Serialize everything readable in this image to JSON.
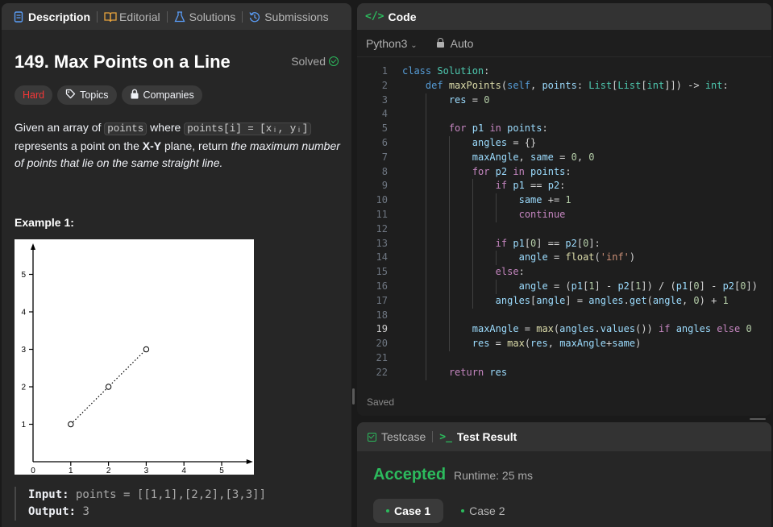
{
  "left_tabs": [
    {
      "label": "Description",
      "icon": "description-icon",
      "active": true
    },
    {
      "label": "Editorial",
      "icon": "book-icon",
      "active": false
    },
    {
      "label": "Solutions",
      "icon": "flask-icon",
      "active": false
    },
    {
      "label": "Submissions",
      "icon": "history-icon",
      "active": false
    }
  ],
  "problem": {
    "title": "149. Max Points on a Line",
    "status": "Solved",
    "tags": {
      "difficulty": "Hard",
      "topics": "Topics",
      "companies": "Companies"
    },
    "desc": {
      "t1": "Given an array of ",
      "c1": "points",
      "t2": " where ",
      "c2": "points[i] = [xᵢ, yᵢ]",
      "t3": " represents a point on the ",
      "b1": "X-Y",
      "t4": " plane, return ",
      "i1": "the maximum number of points that lie on the same straight line."
    },
    "example_title": "Example 1:",
    "input_label": "Input:",
    "input_value": " points = [[1,1],[2,2],[3,3]]",
    "output_label": "Output:",
    "output_value": " 3"
  },
  "chart_data": {
    "type": "scatter",
    "x": [
      1,
      2,
      3
    ],
    "y": [
      1,
      2,
      3
    ],
    "xticks": [
      "0",
      "1",
      "2",
      "3",
      "4",
      "5"
    ],
    "yticks": [
      "1",
      "2",
      "3",
      "4",
      "5"
    ],
    "xlim": [
      0,
      5.7
    ],
    "ylim": [
      0,
      5.7
    ],
    "connect": "dotted"
  },
  "code_panel": {
    "title": "Code",
    "language": "Python3",
    "mode": "Auto",
    "status": "Saved",
    "current_line": 19,
    "lines": [
      {
        "n": "1",
        "indent": 0,
        "src": "class Solution:"
      },
      {
        "n": "2",
        "indent": 1,
        "src": "def maxPoints(self, points: List[List[int]]) -> int:"
      },
      {
        "n": "3",
        "indent": 2,
        "src": "res = 0"
      },
      {
        "n": "4",
        "indent": 2,
        "src": ""
      },
      {
        "n": "5",
        "indent": 2,
        "src": "for p1 in points:"
      },
      {
        "n": "6",
        "indent": 3,
        "src": "angles = {}"
      },
      {
        "n": "7",
        "indent": 3,
        "src": "maxAngle, same = 0, 0"
      },
      {
        "n": "8",
        "indent": 3,
        "src": "for p2 in points:"
      },
      {
        "n": "9",
        "indent": 4,
        "src": "if p1 == p2:"
      },
      {
        "n": "10",
        "indent": 5,
        "src": "same += 1"
      },
      {
        "n": "11",
        "indent": 5,
        "src": "continue"
      },
      {
        "n": "12",
        "indent": 4,
        "src": ""
      },
      {
        "n": "13",
        "indent": 4,
        "src": "if p1[0] == p2[0]:"
      },
      {
        "n": "14",
        "indent": 5,
        "src": "angle = float('inf')"
      },
      {
        "n": "15",
        "indent": 4,
        "src": "else:"
      },
      {
        "n": "16",
        "indent": 5,
        "src": "angle = (p1[1] - p2[1]) / (p1[0] - p2[0])"
      },
      {
        "n": "17",
        "indent": 4,
        "src": "angles[angle] = angles.get(angle, 0) + 1"
      },
      {
        "n": "18",
        "indent": 3,
        "src": ""
      },
      {
        "n": "19",
        "indent": 3,
        "src": "maxAngle = max(angles.values()) if angles else 0"
      },
      {
        "n": "20",
        "indent": 3,
        "src": "res = max(res, maxAngle+same)"
      },
      {
        "n": "21",
        "indent": 2,
        "src": ""
      },
      {
        "n": "22",
        "indent": 2,
        "src": "return res"
      }
    ]
  },
  "result_panel": {
    "tabs": [
      {
        "label": "Testcase",
        "icon": "checkbox-icon",
        "active": false
      },
      {
        "label": "Test Result",
        "icon": "terminal-icon",
        "active": true
      }
    ],
    "verdict": "Accepted",
    "runtime": "Runtime: 25 ms",
    "cases": [
      {
        "label": "Case 1",
        "active": true
      },
      {
        "label": "Case 2",
        "active": false
      }
    ]
  },
  "colors": {
    "accent_green": "#2cbb5d",
    "hard_red": "#f63737",
    "panel_bg": "#262626",
    "editor_bg": "#1e1e1e"
  }
}
